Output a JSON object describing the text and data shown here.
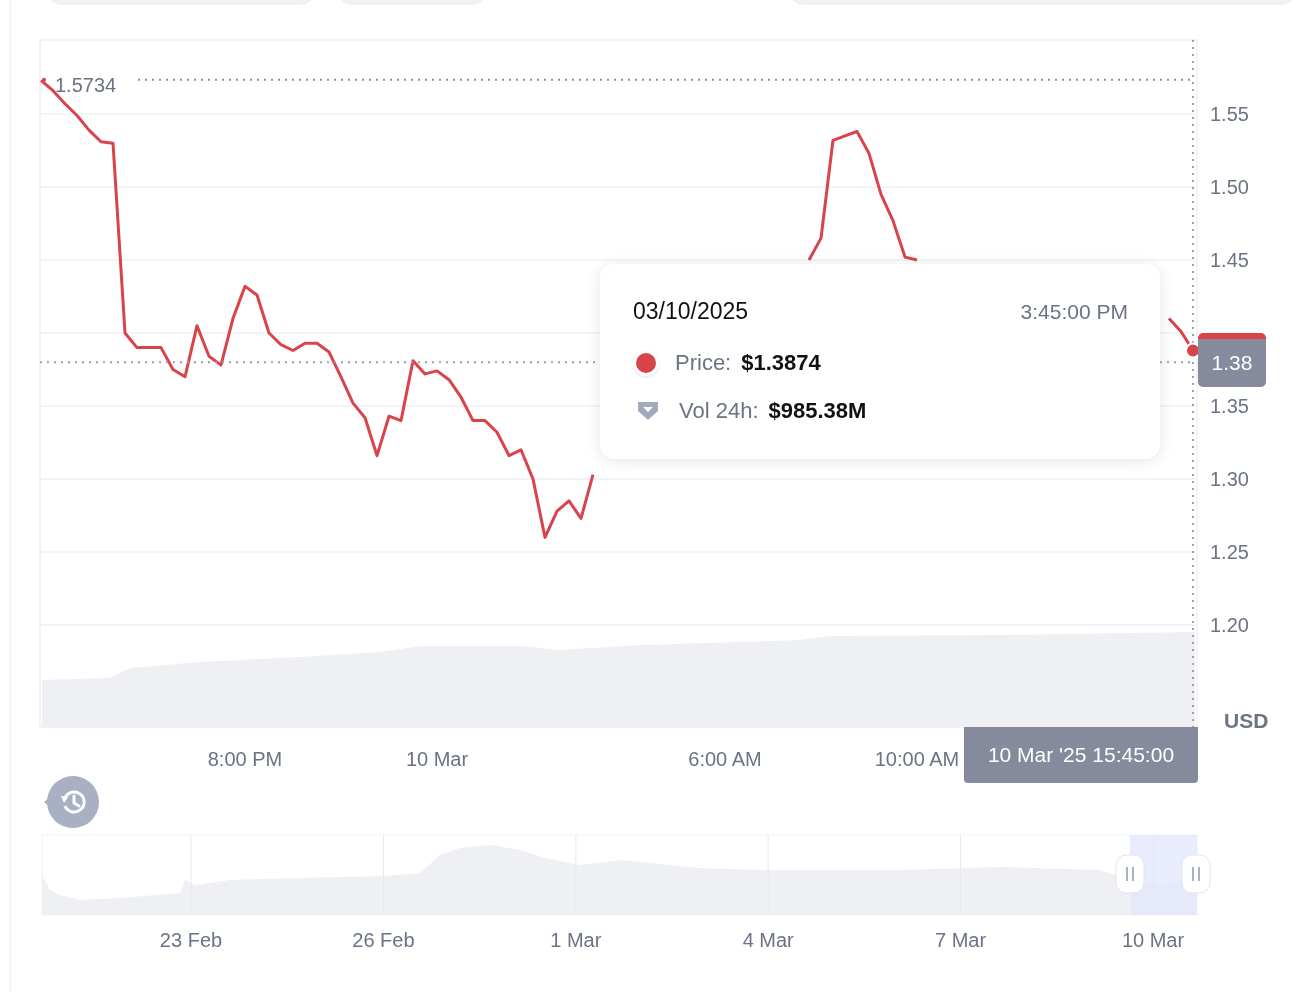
{
  "chart": {
    "chart_data": {
      "type": "line",
      "grid": true,
      "ref_lines": [
        {
          "axis": "y",
          "value": 1.5734,
          "label": "1.5734"
        },
        {
          "axis": "y",
          "value": 1.38,
          "label": "1.38"
        }
      ],
      "categories": [
        null,
        null,
        null,
        null,
        null,
        null,
        null,
        null,
        null,
        null,
        null,
        null,
        null,
        null,
        null,
        null,
        null,
        "8:00 PM",
        null,
        null,
        null,
        null,
        null,
        null,
        null,
        null,
        null,
        null,
        null,
        null,
        null,
        null,
        null,
        "10 Mar",
        null,
        null,
        null,
        null,
        null,
        null,
        null,
        null,
        null,
        null,
        null,
        null,
        null,
        null,
        null,
        null,
        null,
        null,
        null,
        null,
        null,
        null,
        null,
        "6:00 AM",
        null,
        null,
        null,
        null,
        null,
        null,
        null,
        null,
        null,
        null,
        null,
        null,
        null,
        null,
        null,
        "10:00 AM",
        null,
        null,
        null,
        null,
        null,
        null,
        null,
        null,
        null,
        null,
        null,
        null,
        null,
        null,
        null,
        null,
        null,
        null,
        null,
        null,
        null,
        null,
        null
      ],
      "series": [
        {
          "color": "#d9434a",
          "values": [
            1.573,
            1.566,
            1.557,
            1.549,
            1.539,
            1.531,
            1.53,
            1.4,
            1.39,
            1.39,
            1.39,
            1.375,
            1.37,
            1.405,
            1.384,
            1.378,
            1.41,
            1.432,
            1.426,
            1.4,
            1.392,
            1.388,
            1.393,
            1.393,
            1.387,
            1.37,
            1.352,
            1.342,
            1.316,
            1.343,
            1.34,
            1.381,
            1.372,
            1.374,
            1.368,
            1.356,
            1.34,
            1.34,
            1.332,
            1.316,
            1.32,
            1.3,
            1.26,
            1.278,
            1.285,
            1.273,
            1.303,
            null,
            null,
            null,
            null,
            null,
            null,
            null,
            null,
            null,
            null,
            null,
            null,
            null,
            null,
            null,
            null,
            null,
            1.45,
            1.465,
            1.532,
            1.535,
            1.538,
            1.523,
            1.495,
            1.477,
            1.452,
            1.45,
            null,
            null,
            null,
            null,
            null,
            null,
            null,
            null,
            null,
            null,
            null,
            null,
            null,
            null,
            null,
            null,
            null,
            null,
            null,
            null,
            1.41,
            1.401,
            1.388
          ]
        }
      ],
      "ylim": [
        1.1301,
        1.6007
      ],
      "yticks": [
        {
          "value": 1.2,
          "label": "1.20"
        },
        {
          "value": 1.25,
          "label": "1.25"
        },
        {
          "value": 1.3,
          "label": "1.30"
        },
        {
          "value": 1.35,
          "label": "1.35"
        },
        {
          "value": 1.45,
          "label": "1.45"
        },
        {
          "value": 1.5,
          "label": "1.50"
        },
        {
          "value": 1.55,
          "label": "1.55"
        }
      ]
    },
    "time_tag": "10 Mar '25 15:45:00",
    "unit": "USD"
  },
  "tooltip": {
    "date": "03/10/2025",
    "time": "3:45:00 PM",
    "rows": [
      {
        "kind": "price",
        "label": "Price:",
        "value": "$1.3874",
        "color": "#d9434a"
      },
      {
        "kind": "volume",
        "label": "Vol 24h:",
        "value": "$985.38M",
        "color": "#a4aabd"
      }
    ]
  },
  "navigator": {
    "labels": [
      "23 Feb",
      "26 Feb",
      "1 Mar",
      "4 Mar",
      "7 Mar",
      "10 Mar"
    ]
  }
}
